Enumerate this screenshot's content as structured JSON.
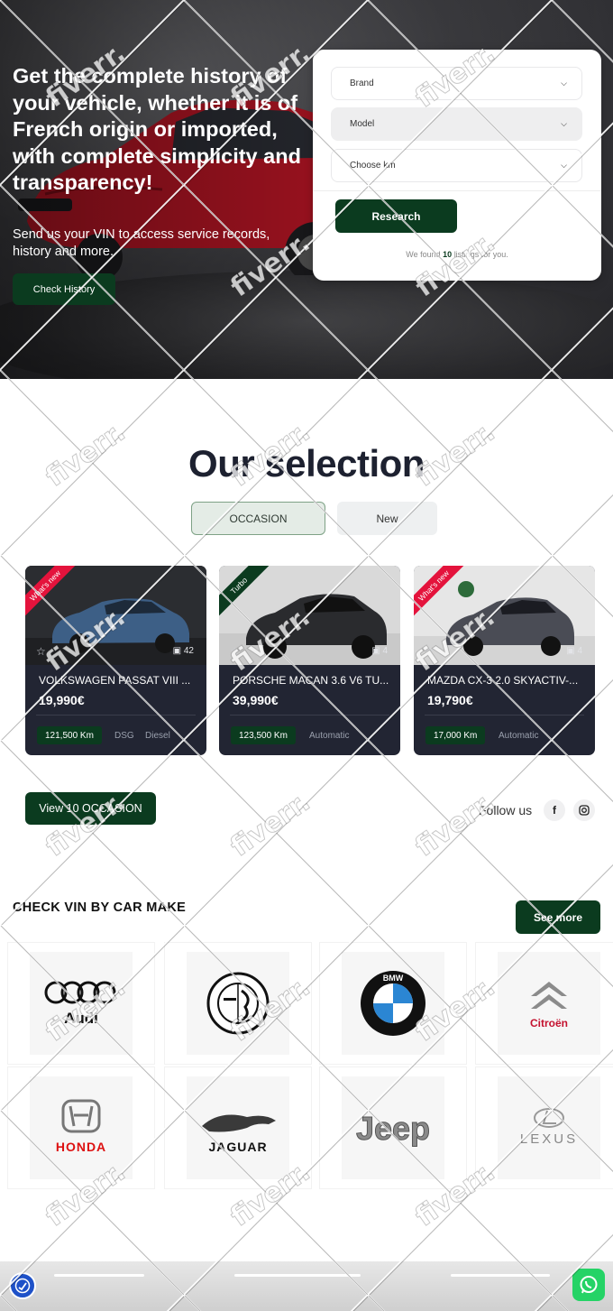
{
  "hero": {
    "headline": "Get the complete history of your vehicle, whether it is of French origin or imported, with complete simplicity and transparency!",
    "subtext": "Send us your VIN to access service records, history and more.",
    "cta": "Check History"
  },
  "search": {
    "brand_label": "Brand",
    "model_label": "Model",
    "km_label": "Choose km",
    "submit": "Research",
    "found_prefix": "We found",
    "found_count": "10",
    "found_suffix": "listings for you."
  },
  "selection": {
    "title": "Our selection",
    "tabs": [
      {
        "label": "OCCASION",
        "active": true
      },
      {
        "label": "New",
        "active": false
      }
    ],
    "cars": [
      {
        "ribbon": "What's new",
        "ribbon_color": "#e4133c",
        "photos": "42",
        "name": "VOLKSWAGEN PASSAT VIII ...",
        "price": "19,990€",
        "km": "121,500 Km",
        "specs": [
          "DSG",
          "Diesel"
        ]
      },
      {
        "ribbon": "Turbo",
        "ribbon_color": "#0b3b1f",
        "photos": "4",
        "name": "PORSCHE MACAN 3.6 V6 TU...",
        "price": "39,990€",
        "km": "123,500 Km",
        "specs": [
          "Automatic"
        ]
      },
      {
        "ribbon": "What's new",
        "ribbon_color": "#e4133c",
        "photos": "4",
        "name": "MAZDA CX-3 2.0 SKYACTIV-...",
        "price": "19,790€",
        "km": "17,000 Km",
        "specs": [
          "Automatic"
        ]
      }
    ],
    "view_all": "View 10 OCCASION",
    "follow_label": "Follow us",
    "social": [
      "facebook-icon",
      "instagram-icon"
    ]
  },
  "makes": {
    "title": "CHECK VIN BY CAR MAKE",
    "see_more": "See more",
    "brands": [
      "Audi",
      "Alfa Romeo",
      "BMW",
      "Citroën",
      "Honda",
      "Jaguar",
      "Jeep",
      "Lexus"
    ]
  },
  "watermark": "fiverr.",
  "colors": {
    "brand_green": "#0b3b1f",
    "card_bg": "#222533",
    "accent_red": "#e4133c"
  }
}
